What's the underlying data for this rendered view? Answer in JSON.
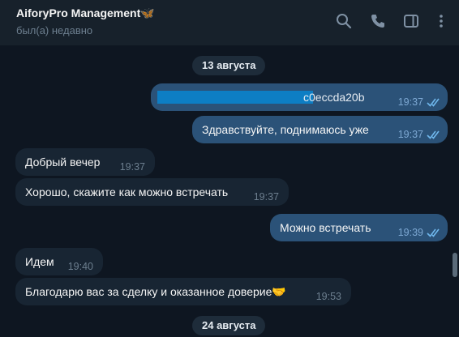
{
  "header": {
    "title": "AiforyPro Management",
    "title_emoji": "🦋",
    "status": "был(а) недавно",
    "icons": [
      "search-icon",
      "phone-icon",
      "sidebar-toggle-icon",
      "more-icon"
    ]
  },
  "colors": {
    "background": "#0e1621",
    "header": "#17212b",
    "outgoing_bubble": "#2b5278",
    "incoming_bubble": "#182533",
    "read_ticks": "#6fb7ec"
  },
  "messages": [
    {
      "type": "date",
      "text": "13 августа"
    },
    {
      "type": "out",
      "text": "c0eccda20b",
      "redacted": true,
      "time": "19:37",
      "read": true
    },
    {
      "type": "out",
      "text": "Здравствуйте, поднимаюсь уже",
      "time": "19:37",
      "read": true
    },
    {
      "type": "in",
      "text": "Добрый вечер",
      "time": "19:37"
    },
    {
      "type": "in",
      "text": "Хорошо, скажите как можно встречать",
      "time": "19:37"
    },
    {
      "type": "out",
      "text": "Можно встречать",
      "time": "19:39",
      "read": true
    },
    {
      "type": "in",
      "text": "Идем",
      "time": "19:40"
    },
    {
      "type": "in",
      "text": "Благодарю вас за сделку и оказанное доверие🤝",
      "time": "19:53"
    },
    {
      "type": "date",
      "text": "24 августа"
    }
  ]
}
